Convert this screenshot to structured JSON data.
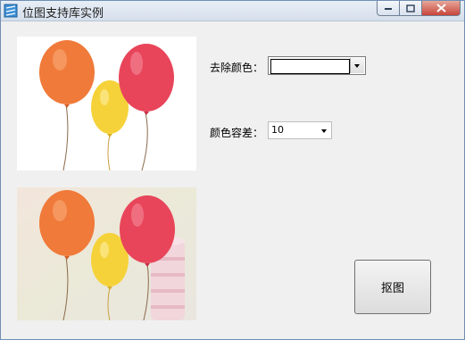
{
  "window": {
    "title": "位图支持库实例",
    "icon": "app-icon"
  },
  "title_controls": {
    "minimize_icon": "minimize-icon",
    "maximize_icon": "maximize-icon",
    "close_icon": "close-icon"
  },
  "pictures": {
    "original": {
      "icon": "balloons-image",
      "background": "white"
    },
    "processed": {
      "icon": "balloons-image",
      "background": "pastel"
    }
  },
  "remove_color": {
    "label": "去除颜色：",
    "value": "",
    "dropdown_icon": "chevron-down-icon"
  },
  "tolerance": {
    "label": "颜色容差：",
    "value": "10",
    "dropdown_icon": "chevron-down-icon"
  },
  "cutout_button": {
    "label": "抠图"
  },
  "colors": {
    "orange": "#f07a3a",
    "yellow": "#f6d23a",
    "red": "#e8455a",
    "title_bar": "#dce5f0",
    "close": "#c8453a"
  }
}
